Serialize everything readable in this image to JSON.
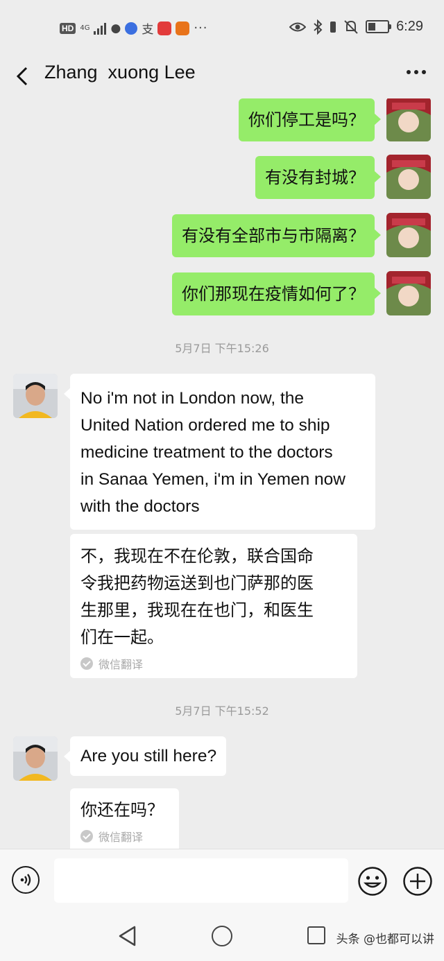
{
  "status_bar": {
    "hd": "HD",
    "network": "4G",
    "time": "6:29",
    "battery_level": 0.4
  },
  "header": {
    "title": "Zhang  xuong Lee"
  },
  "messages": [
    {
      "direction": "out",
      "text": "你们停工是吗？"
    },
    {
      "direction": "out",
      "text": "有没有封城？"
    },
    {
      "direction": "out",
      "text": "有没有全部市与市隔离？"
    },
    {
      "direction": "out",
      "text": "你们那现在疫情如何了？"
    },
    {
      "type": "timestamp",
      "text": "5月7日 下午15:26"
    },
    {
      "direction": "in",
      "text": [
        "No i'm not in London now, the",
        "United Nation ordered me to ship",
        "medicine treatment to the doctors",
        "in Sanaa Yemen, i'm in Yemen now",
        "with the doctors"
      ]
    },
    {
      "direction": "in-translation",
      "text": [
        "不，我现在不在伦敦，联合国命",
        "令我把药物运送到也门萨那的医",
        "生那里，我现在在也门，和医生",
        "们在一起。"
      ],
      "label": "微信翻译"
    },
    {
      "type": "timestamp",
      "text": "5月7日 下午15:52"
    },
    {
      "direction": "in",
      "text": [
        "Are you still here?"
      ]
    },
    {
      "direction": "in-translation",
      "text": [
        "你还在吗？"
      ],
      "label": "微信翻译"
    }
  ],
  "input_bar": {
    "text": ""
  },
  "watermark": "头条 @也都可以讲",
  "colors": {
    "background": "#ededed",
    "outgoing_bubble": "#95ec69",
    "incoming_bubble": "#ffffff"
  }
}
